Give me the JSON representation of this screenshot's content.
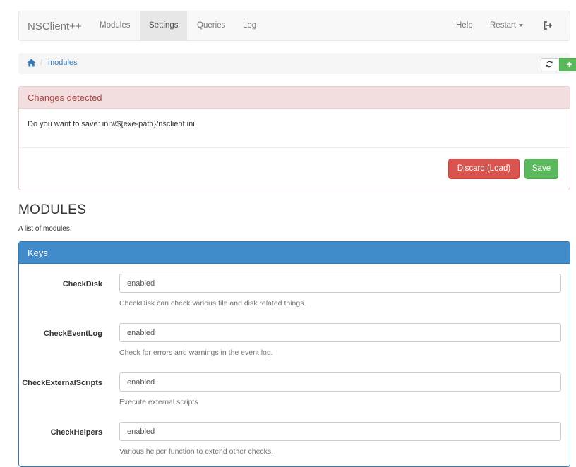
{
  "navbar": {
    "brand": "NSClient++",
    "items": [
      {
        "label": "Modules"
      },
      {
        "label": "Settings"
      },
      {
        "label": "Queries"
      },
      {
        "label": "Log"
      }
    ],
    "help": "Help",
    "restart": "Restart"
  },
  "breadcrumb": {
    "current": "modules",
    "separator": "/"
  },
  "buttons": {
    "add": "+"
  },
  "alert": {
    "title": "Changes detected",
    "message": "Do you want to save: ini://${exe-path}/nsclient.ini",
    "discard": "Discard (Load)",
    "save": "Save"
  },
  "page": {
    "title": "MODULES",
    "subtitle": "A list of modules."
  },
  "keys": {
    "heading": "Keys",
    "rows": [
      {
        "label": "CheckDisk",
        "value": "enabled",
        "help": "CheckDisk can check various file and disk related things."
      },
      {
        "label": "CheckEventLog",
        "value": "enabled",
        "help": "Check for errors and warnings in the event log."
      },
      {
        "label": "CheckExternalScripts",
        "value": "enabled",
        "help": "Execute external scripts"
      },
      {
        "label": "CheckHelpers",
        "value": "enabled",
        "help": "Various helper function to extend other checks."
      }
    ]
  },
  "colors": {
    "primary": "#428bca",
    "danger": "#d9534f",
    "success": "#5cb85c",
    "alert_bg": "#f2dede"
  }
}
